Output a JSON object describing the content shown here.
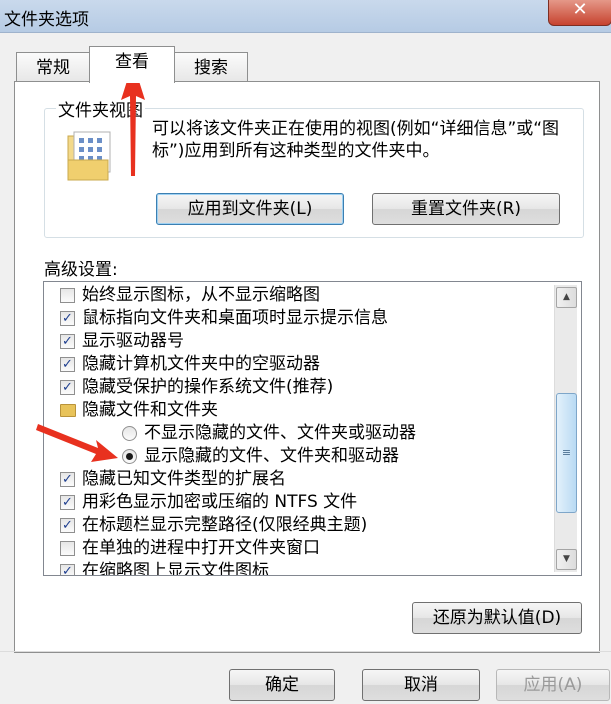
{
  "window": {
    "title": "文件夹选项",
    "close_glyph": "✕"
  },
  "tabs": [
    {
      "label": "常规"
    },
    {
      "label": "查看"
    },
    {
      "label": "搜索"
    }
  ],
  "folder_views": {
    "group_title": "文件夹视图",
    "description": "可以将该文件夹正在使用的视图(例如“详细信息”或“图标”)应用到所有这种类型的文件夹中。",
    "apply_button": "应用到文件夹(L)",
    "reset_button": "重置文件夹(R)"
  },
  "advanced": {
    "label": "高级设置:",
    "items": [
      {
        "label": "始终显示图标，从不显示缩略图",
        "type": "checkbox",
        "checked": false
      },
      {
        "label": "鼠标指向文件夹和桌面项时显示提示信息",
        "type": "checkbox",
        "checked": true
      },
      {
        "label": "显示驱动器号",
        "type": "checkbox",
        "checked": true
      },
      {
        "label": "隐藏计算机文件夹中的空驱动器",
        "type": "checkbox",
        "checked": true
      },
      {
        "label": "隐藏受保护的操作系统文件(推荐)",
        "type": "checkbox",
        "checked": true
      },
      {
        "label": "隐藏文件和文件夹",
        "type": "folder"
      },
      {
        "label": "不显示隐藏的文件、文件夹或驱动器",
        "type": "radio",
        "checked": false
      },
      {
        "label": "显示隐藏的文件、文件夹和驱动器",
        "type": "radio",
        "checked": true
      },
      {
        "label": "隐藏已知文件类型的扩展名",
        "type": "checkbox",
        "checked": true
      },
      {
        "label": "用彩色显示加密或压缩的 NTFS 文件",
        "type": "checkbox",
        "checked": true
      },
      {
        "label": "在标题栏显示完整路径(仅限经典主题)",
        "type": "checkbox",
        "checked": true
      },
      {
        "label": "在单独的进程中打开文件夹窗口",
        "type": "checkbox",
        "checked": false
      },
      {
        "label": "在缩略图上显示文件图标",
        "type": "checkbox",
        "checked": true
      }
    ],
    "restore_button": "还原为默认值(D)"
  },
  "footer": {
    "ok_button": "确定",
    "cancel_button": "取消",
    "apply_button": "应用(A)"
  },
  "colors": {
    "annotation_arrow": "#e8311f",
    "check_mark": "#1f3f8f",
    "titlebar": "#c4d5ea"
  }
}
